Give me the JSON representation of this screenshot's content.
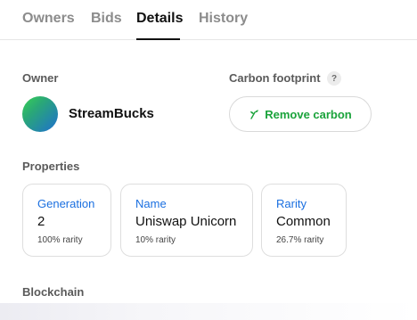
{
  "tabs": [
    {
      "label": "Owners",
      "active": false
    },
    {
      "label": "Bids",
      "active": false
    },
    {
      "label": "Details",
      "active": true
    },
    {
      "label": "History",
      "active": false
    }
  ],
  "owner": {
    "section_label": "Owner",
    "name": "StreamBucks"
  },
  "carbon": {
    "section_label": "Carbon footprint",
    "help_glyph": "?",
    "button_label": "Remove carbon",
    "button_icon": "sprout-icon",
    "accent_color": "#1aa33b"
  },
  "properties": {
    "section_label": "Properties",
    "items": [
      {
        "type": "Generation",
        "value": "2",
        "rarity": "100% rarity"
      },
      {
        "type": "Name",
        "value": "Uniswap Unicorn",
        "rarity": "10% rarity"
      },
      {
        "type": "Rarity",
        "value": "Common",
        "rarity": "26.7% rarity"
      }
    ]
  },
  "blockchain": {
    "section_label": "Blockchain"
  }
}
